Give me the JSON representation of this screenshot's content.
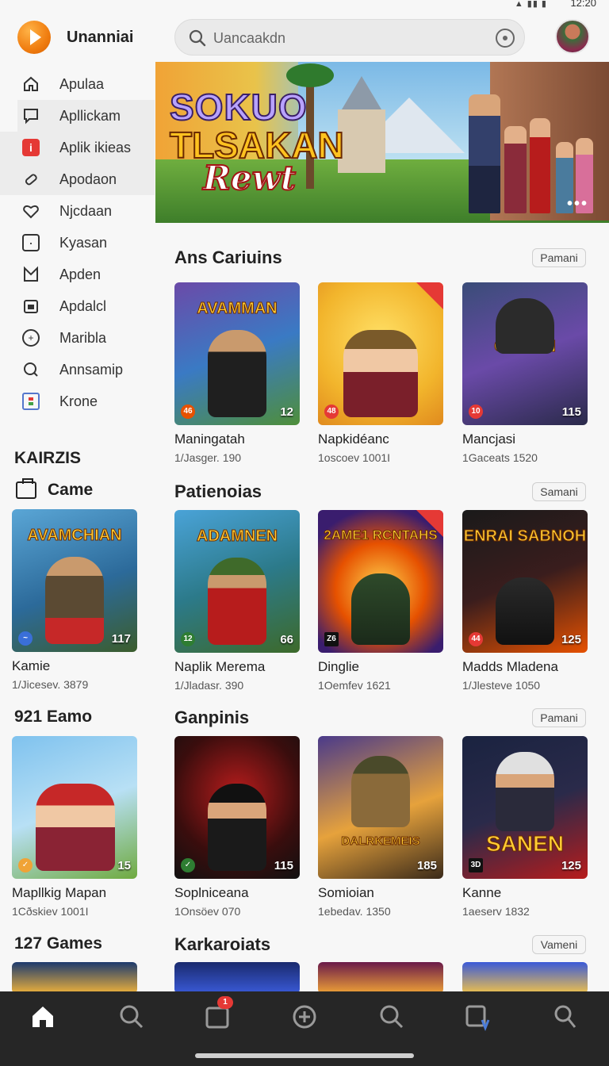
{
  "status": {
    "time": "12:20",
    "signal": "▲ ▮▮ ▮"
  },
  "header": {
    "app_name": "Unanniai",
    "search_placeholder": "Uancaakdn"
  },
  "sidebar": {
    "items": [
      {
        "label": "Apulaa",
        "icon": "home-icon"
      },
      {
        "label": "Apllickam",
        "icon": "chat-icon"
      },
      {
        "label": "Aplik ikieas",
        "icon": "info-icon"
      },
      {
        "label": "Apodaon",
        "icon": "tag-icon"
      },
      {
        "label": "Njcdaan",
        "icon": "heart-icon"
      },
      {
        "label": "Kyasan",
        "icon": "square-icon"
      },
      {
        "label": "Apden",
        "icon": "mail-icon"
      },
      {
        "label": "Apdalcl",
        "icon": "calendar-icon"
      },
      {
        "label": "Maribla",
        "icon": "compass-icon"
      },
      {
        "label": "Annsamip",
        "icon": "search-icon"
      },
      {
        "label": "Krone",
        "icon": "traffic-icon"
      }
    ]
  },
  "hero": {
    "line1": "SOKUO",
    "line2": "TLSAKAN",
    "line3": "Rewt",
    "more": "•••"
  },
  "left_column": {
    "heading1": "KAIRZIS",
    "game_label": "Came",
    "heading2": "921 Eamo",
    "heading3": "127 Games",
    "cards": [
      {
        "art": "AVAMCHIAN",
        "title": "Kamie",
        "sub": "1/Jicesev. 3879",
        "rating": "117"
      },
      {
        "art": "",
        "title": "Mapllkig Mapan",
        "sub": "1Cðskiev 1001I",
        "rating": "15"
      }
    ]
  },
  "sections": [
    {
      "title": "Ans Cariuins",
      "btn": "Pamani",
      "cards": [
        {
          "art": "AVAMMAN",
          "title": "Maningatah",
          "sub": "1/Jasger. 190",
          "rating": "12",
          "badge": "46"
        },
        {
          "art": "",
          "title": "Napkidéanc",
          "sub": "1oscoev 1001I",
          "rating": "",
          "badge": "48"
        },
        {
          "art": "CIADAN",
          "title": "Mancjasi",
          "sub": "1Gaceats 1520",
          "rating": "115",
          "badge": "10"
        }
      ]
    },
    {
      "title": "Patienoias",
      "btn": "Samani",
      "cards": [
        {
          "art": "ADAMNEN",
          "title": "Naplik Merema",
          "sub": "1/Jladasr. 390",
          "rating": "66",
          "badge": "12"
        },
        {
          "art": "2AME1 RCNTAHS",
          "title": "Dinglie",
          "sub": "1Oemfev 1621",
          "rating": "",
          "badge": "Z6"
        },
        {
          "art": "ENRAI SABNOH",
          "title": "Madds Mladena",
          "sub": "1/Jlesteve 1050",
          "rating": "125",
          "badge": "44"
        }
      ]
    },
    {
      "title": "Ganpinis",
      "btn": "Pamani",
      "cards": [
        {
          "art": "",
          "title": "Soplniceana",
          "sub": "1Onsöev 070",
          "rating": "115",
          "badge": "✓"
        },
        {
          "art": "DALRKEMEIS",
          "title": "Somioian",
          "sub": "1ebedav. 1350",
          "rating": "185",
          "badge": ""
        },
        {
          "art": "SANEN",
          "title": "Kanne",
          "sub": "1aeserv 1832",
          "rating": "125",
          "badge": "3D"
        }
      ]
    },
    {
      "title": "Karkaroiats",
      "btn": "Vameni",
      "cards": []
    }
  ],
  "bottom_nav": {
    "badge": "1"
  },
  "colors": {
    "accent": "#f07d10",
    "nav_bg": "#262626",
    "badge": "#e53935"
  }
}
